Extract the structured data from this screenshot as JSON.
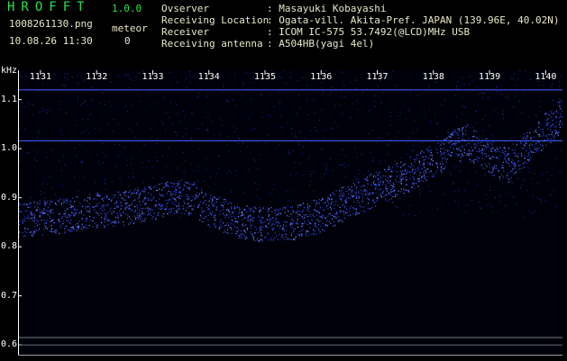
{
  "app": {
    "title": "HROFFT",
    "version": "1.0.0"
  },
  "file": {
    "name": "1008261130.png",
    "datetime": "10.08.26 11:30"
  },
  "meteor": {
    "label": "meteor",
    "count": "0"
  },
  "info": [
    {
      "key": "Ovserver",
      "value": ": Masayuki Kobayashi"
    },
    {
      "key": "Receiving Location",
      "value": ": Ogata-vill. Akita-Pref. JAPAN (139.96E, 40.02N)"
    },
    {
      "key": "Receiver",
      "value": ": ICOM IC-575 53.7492(@LCD)MHz USB"
    },
    {
      "key": "Receiving antenna",
      "value": ": A504HB(yagi 4el)"
    }
  ],
  "colors": {
    "title_green": "#29e24a",
    "signal_blue": "#3a56ff",
    "text": "#e8e8c8"
  },
  "chart_data": {
    "type": "heatmap",
    "ylabel": "kHz",
    "x_ticks": [
      "1131",
      "1132",
      "1133",
      "1134",
      "1135",
      "1136",
      "1137",
      "1138",
      "1139",
      "1140"
    ],
    "y_ticks": [
      "1.1",
      "1.0",
      "0.9",
      "0.8",
      "0.7",
      "0.6"
    ],
    "ylim": [
      0.58,
      1.16
    ],
    "xlim": [
      1130.6,
      1140.3
    ],
    "carrier_lines_khz": [
      1.12,
      1.016
    ],
    "trace": {
      "x": [
        1130.6,
        1131.0,
        1131.5,
        1132.0,
        1132.5,
        1133.0,
        1133.4,
        1133.7,
        1134.0,
        1134.5,
        1135.0,
        1135.5,
        1136.0,
        1136.5,
        1137.0,
        1137.5,
        1138.0,
        1138.3,
        1138.6,
        1139.0,
        1139.3,
        1139.6,
        1140.0,
        1140.3
      ],
      "y": [
        0.855,
        0.86,
        0.865,
        0.875,
        0.88,
        0.89,
        0.905,
        0.9,
        0.875,
        0.855,
        0.845,
        0.85,
        0.865,
        0.895,
        0.92,
        0.945,
        0.975,
        1.005,
        1.015,
        0.985,
        0.965,
        0.995,
        1.04,
        1.07
      ]
    }
  }
}
